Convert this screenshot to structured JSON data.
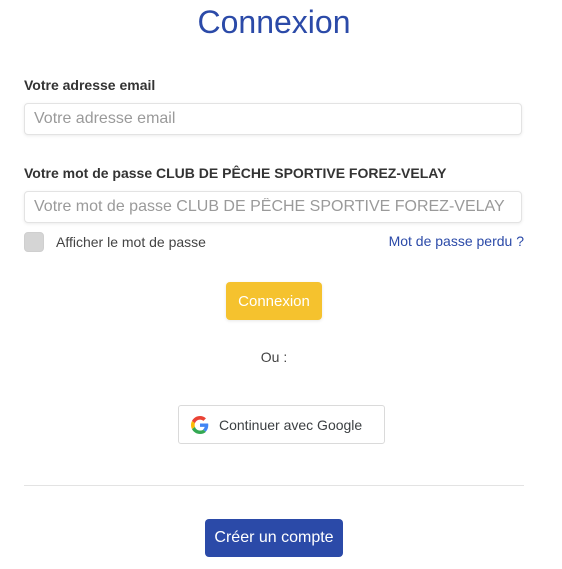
{
  "title": "Connexion",
  "email": {
    "label": "Votre adresse email",
    "placeholder": "Votre adresse email",
    "value": ""
  },
  "password": {
    "label": "Votre mot de passe CLUB DE PÊCHE SPORTIVE FOREZ-VELAY",
    "placeholder": "Votre mot de passe CLUB DE PÊCHE SPORTIVE FOREZ-VELAY",
    "value": ""
  },
  "show_password": {
    "label": "Afficher le mot de passe",
    "checked": false
  },
  "forgot_password": "Mot de passe perdu ?",
  "login_button": "Connexion",
  "or_text": "Ou :",
  "google_button": {
    "label": "Continuer avec Google",
    "icon": "google-logo-icon"
  },
  "create_account_button": "Créer un compte",
  "colors": {
    "primary": "#2b4aa8",
    "accent": "#f5c22e"
  }
}
